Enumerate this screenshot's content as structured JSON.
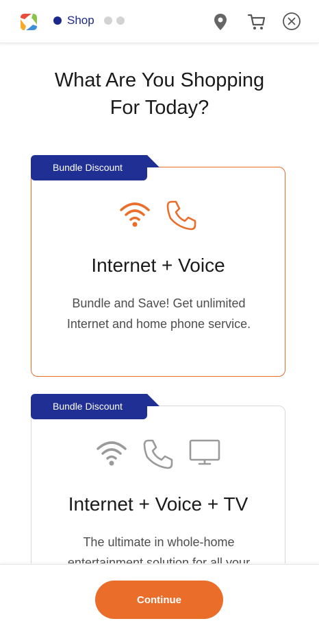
{
  "header": {
    "step_label": "Shop",
    "icons": [
      "logo-icon",
      "location-pin-icon",
      "cart-icon",
      "close-icon"
    ]
  },
  "page": {
    "title_line1": "What Are You Shopping",
    "title_line2": "For Today?"
  },
  "cards": [
    {
      "badge": "Bundle Discount",
      "title": "Internet + Voice",
      "description": "Bundle and Save! Get unlimited Internet and home phone service.",
      "selected": true,
      "icons": [
        "wifi-icon",
        "phone-icon"
      ]
    },
    {
      "badge": "Bundle Discount",
      "title": "Internet + Voice + TV",
      "description": "The ultimate in whole-home entertainment solution for all your",
      "selected": false,
      "icons": [
        "wifi-icon",
        "phone-icon",
        "tv-icon"
      ]
    }
  ],
  "footer": {
    "continue_label": "Continue"
  },
  "colors": {
    "accent": "#ea6d2a",
    "brand_blue": "#1f2f94",
    "inactive_icon": "#9a9a9a"
  }
}
